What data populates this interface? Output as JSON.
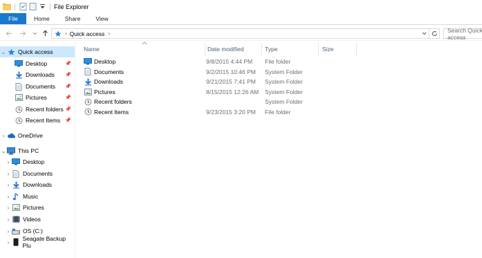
{
  "window": {
    "title": "File Explorer"
  },
  "ribbon": {
    "tabs": [
      "File",
      "Home",
      "Share",
      "View"
    ]
  },
  "address": {
    "crumb": "Quick access",
    "search_placeholder": "Search Quick access"
  },
  "sidebar": {
    "quick_access": {
      "label": "Quick access"
    },
    "pinned": [
      {
        "label": "Desktop",
        "icon": "desktop-icon"
      },
      {
        "label": "Downloads",
        "icon": "downloads-icon"
      },
      {
        "label": "Documents",
        "icon": "documents-icon"
      },
      {
        "label": "Pictures",
        "icon": "pictures-icon"
      },
      {
        "label": "Recent folders",
        "icon": "recent-folders-icon"
      },
      {
        "label": "Recent Items",
        "icon": "recent-items-icon"
      }
    ],
    "onedrive": {
      "label": "OneDrive"
    },
    "this_pc": {
      "label": "This PC"
    },
    "pc_items": [
      {
        "label": "Desktop",
        "icon": "desktop-icon"
      },
      {
        "label": "Documents",
        "icon": "documents-icon"
      },
      {
        "label": "Downloads",
        "icon": "downloads-icon"
      },
      {
        "label": "Music",
        "icon": "music-icon"
      },
      {
        "label": "Pictures",
        "icon": "pictures-icon"
      },
      {
        "label": "Videos",
        "icon": "videos-icon"
      },
      {
        "label": "OS (C:)",
        "icon": "drive-icon"
      },
      {
        "label": "Seagate Backup Plu",
        "icon": "external-drive-icon"
      }
    ]
  },
  "columns": {
    "name": "Name",
    "date": "Date modified",
    "type": "Type",
    "size": "Size"
  },
  "files": [
    {
      "name": "Desktop",
      "date": "9/8/2015 4:44 PM",
      "type": "File folder",
      "icon": "desktop-icon"
    },
    {
      "name": "Documents",
      "date": "9/2/2015 10:46 PM",
      "type": "System Folder",
      "icon": "documents-icon"
    },
    {
      "name": "Downloads",
      "date": "9/21/2015 7:41 PM",
      "type": "System Folder",
      "icon": "downloads-icon"
    },
    {
      "name": "Pictures",
      "date": "8/15/2015 12:26 AM",
      "type": "System Folder",
      "icon": "pictures-icon"
    },
    {
      "name": "Recent folders",
      "date": "",
      "type": "System Folder",
      "icon": "recent-folders-icon"
    },
    {
      "name": "Recent Items",
      "date": "9/23/2015 3:20 PM",
      "type": "File folder",
      "icon": "recent-items-icon"
    }
  ],
  "colors": {
    "accent": "#1979ca",
    "selection": "#cce8ff",
    "header_text": "#4c607a",
    "secondary_text": "#6d6d6d"
  }
}
